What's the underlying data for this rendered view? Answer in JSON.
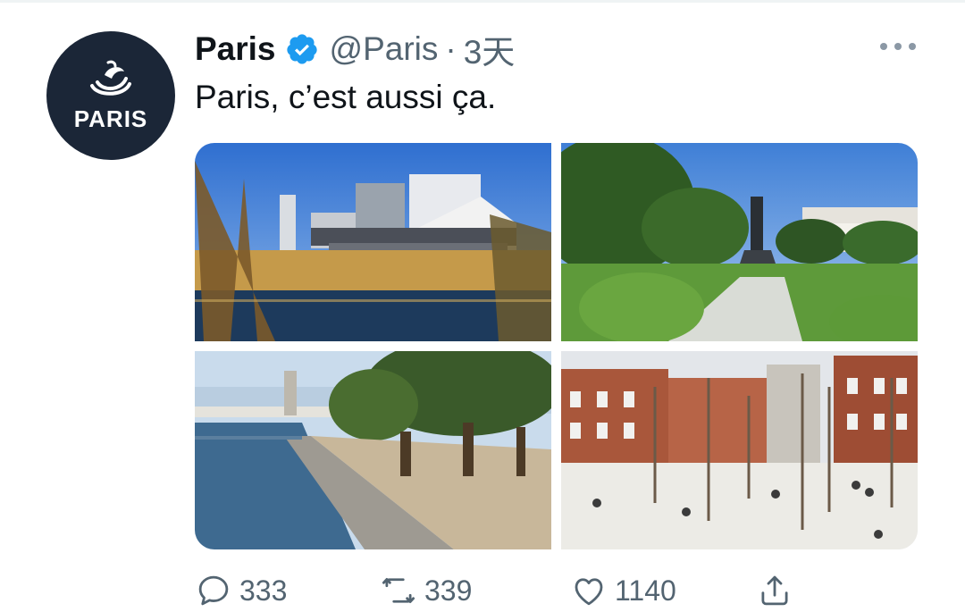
{
  "tweet": {
    "display_name": "Paris",
    "handle": "@Paris",
    "separator": "·",
    "time": "3天",
    "text": "Paris, c’est aussi ça.",
    "avatar_text": "PARIS",
    "verified_icon": "verified-badge-icon",
    "more_icon": "more-horizontal-icon"
  },
  "media": [
    {
      "name": "photo-building-reeds",
      "description_icon": "photo"
    },
    {
      "name": "photo-park-statue",
      "description_icon": "photo"
    },
    {
      "name": "photo-seine-river",
      "description_icon": "photo"
    },
    {
      "name": "photo-courtyard-trees",
      "description_icon": "photo"
    }
  ],
  "actions": {
    "reply_count": "333",
    "retweet_count": "339",
    "like_count": "1140",
    "reply_icon": "reply-icon",
    "retweet_icon": "retweet-icon",
    "like_icon": "heart-icon",
    "share_icon": "share-icon"
  },
  "colors": {
    "text_primary": "#0f1419",
    "text_secondary": "#536471",
    "verified_blue": "#1d9bf0",
    "avatar_bg": "#1b2637"
  }
}
